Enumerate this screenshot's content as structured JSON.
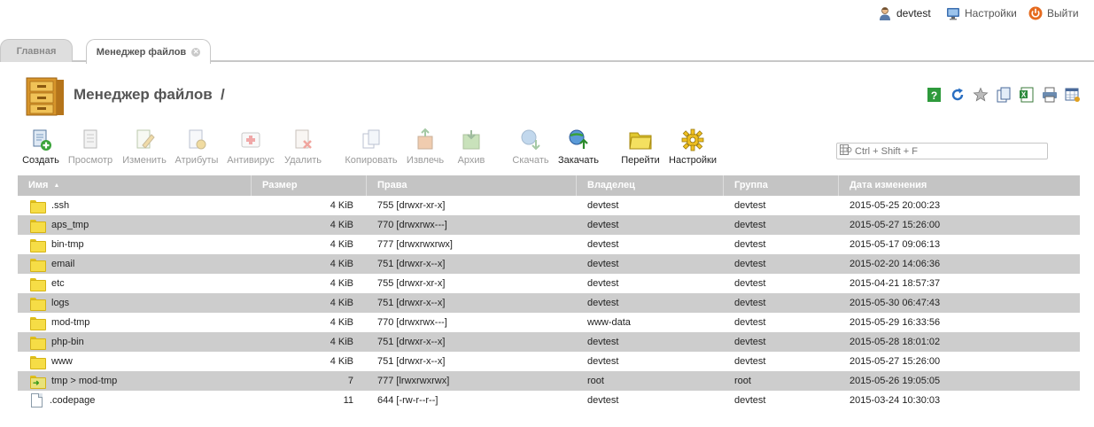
{
  "topbar": {
    "user": "devtest",
    "settings": "Настройки",
    "logout": "Выйти"
  },
  "tabs": [
    {
      "label": "Главная"
    },
    {
      "label": "Менеджер файлов"
    }
  ],
  "title": {
    "text": "Менеджер файлов",
    "path": "/"
  },
  "toolbar": [
    {
      "label": "Создать",
      "icon": "create-icon",
      "enabled": true
    },
    {
      "label": "Просмотр",
      "icon": "view-icon",
      "enabled": false
    },
    {
      "label": "Изменить",
      "icon": "edit-icon",
      "enabled": false
    },
    {
      "label": "Атрибуты",
      "icon": "attributes-icon",
      "enabled": false
    },
    {
      "label": "Антивирус",
      "icon": "antivirus-icon",
      "enabled": false
    },
    {
      "label": "Удалить",
      "icon": "delete-icon",
      "enabled": false
    },
    {
      "label": "Копировать",
      "icon": "copy-icon",
      "enabled": false
    },
    {
      "label": "Извлечь",
      "icon": "extract-icon",
      "enabled": false
    },
    {
      "label": "Архив",
      "icon": "archive-icon",
      "enabled": false
    },
    {
      "label": "Скачать",
      "icon": "download-icon",
      "enabled": false
    },
    {
      "label": "Закачать",
      "icon": "upload-icon",
      "enabled": true
    },
    {
      "label": "Перейти",
      "icon": "goto-folder-icon",
      "enabled": true
    },
    {
      "label": "Настройки",
      "icon": "settings-gear-icon",
      "enabled": true
    }
  ],
  "tool_icons": [
    "help-icon",
    "refresh-icon",
    "favorite-star-icon",
    "copy-page-icon",
    "export-excel-icon",
    "print-icon",
    "table-settings-icon"
  ],
  "search": {
    "placeholder": "Ctrl + Shift + F"
  },
  "table": {
    "columns": [
      "Имя",
      "Размер",
      "Права",
      "Владелец",
      "Группа",
      "Дата изменения"
    ],
    "sort_column": "Имя",
    "sort_dir": "asc",
    "rows": [
      {
        "name": ".ssh",
        "type": "folder",
        "size": "4 KiB",
        "perm": "755 [drwxr-xr-x]",
        "owner": "devtest",
        "group": "devtest",
        "date": "2015-05-25 20:00:23"
      },
      {
        "name": "aps_tmp",
        "type": "folder",
        "size": "4 KiB",
        "perm": "770 [drwxrwx---]",
        "owner": "devtest",
        "group": "devtest",
        "date": "2015-05-27 15:26:00"
      },
      {
        "name": "bin-tmp",
        "type": "folder",
        "size": "4 KiB",
        "perm": "777 [drwxrwxrwx]",
        "owner": "devtest",
        "group": "devtest",
        "date": "2015-05-17 09:06:13"
      },
      {
        "name": "email",
        "type": "folder",
        "size": "4 KiB",
        "perm": "751 [drwxr-x--x]",
        "owner": "devtest",
        "group": "devtest",
        "date": "2015-02-20 14:06:36"
      },
      {
        "name": "etc",
        "type": "folder",
        "size": "4 KiB",
        "perm": "755 [drwxr-xr-x]",
        "owner": "devtest",
        "group": "devtest",
        "date": "2015-04-21 18:57:37"
      },
      {
        "name": "logs",
        "type": "folder",
        "size": "4 KiB",
        "perm": "751 [drwxr-x--x]",
        "owner": "devtest",
        "group": "devtest",
        "date": "2015-05-30 06:47:43"
      },
      {
        "name": "mod-tmp",
        "type": "folder",
        "size": "4 KiB",
        "perm": "770 [drwxrwx---]",
        "owner": "www-data",
        "group": "devtest",
        "date": "2015-05-29 16:33:56"
      },
      {
        "name": "php-bin",
        "type": "folder",
        "size": "4 KiB",
        "perm": "751 [drwxr-x--x]",
        "owner": "devtest",
        "group": "devtest",
        "date": "2015-05-28 18:01:02"
      },
      {
        "name": "www",
        "type": "folder",
        "size": "4 KiB",
        "perm": "751 [drwxr-x--x]",
        "owner": "devtest",
        "group": "devtest",
        "date": "2015-05-27 15:26:00"
      },
      {
        "name": "tmp > mod-tmp",
        "type": "link",
        "size": "7",
        "perm": "777 [lrwxrwxrwx]",
        "owner": "root",
        "group": "root",
        "date": "2015-05-26 19:05:05"
      },
      {
        "name": ".codepage",
        "type": "file",
        "size": "11",
        "perm": "644 [-rw-r--r--]",
        "owner": "devtest",
        "group": "devtest",
        "date": "2015-03-24 10:30:03"
      }
    ]
  }
}
